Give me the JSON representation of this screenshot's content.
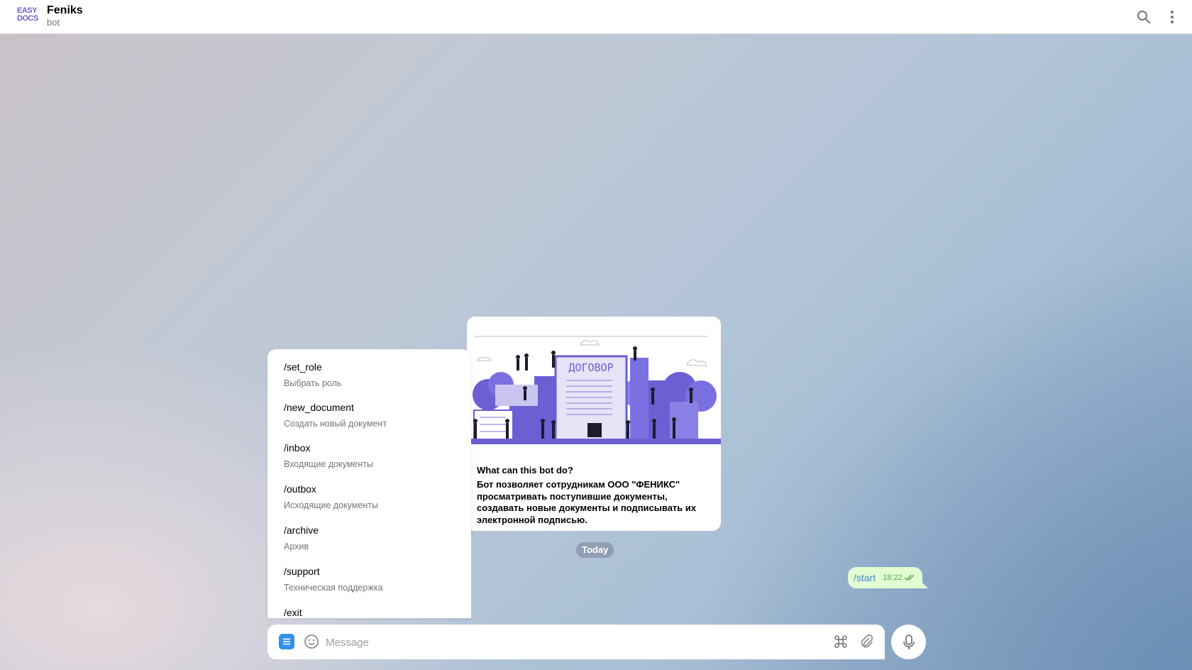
{
  "header": {
    "logo_line1": "EASY",
    "logo_line2": "DOCS",
    "title": "Feniks",
    "subtitle": "bot",
    "search_icon": "search-icon",
    "more_icon": "more-vertical-icon"
  },
  "info_card": {
    "image_label": "ДОГОВОР",
    "question": "What can this bot do?",
    "description": "Бот позволяет сотрудникам ООО \"ФЕНИКС\" просматривать поступившие документы, создавать новые документы и подписывать их электронной подписью."
  },
  "date_separator": "Today",
  "outgoing_message": {
    "text": "/start",
    "time": "18:22",
    "status_icon": "double-check-icon"
  },
  "commands": [
    {
      "name": "/set_role",
      "description": "Выбрать роль"
    },
    {
      "name": "/new_document",
      "description": "Создать новый документ"
    },
    {
      "name": "/inbox",
      "description": "Входящие документы"
    },
    {
      "name": "/outbox",
      "description": "Исходящие документы"
    },
    {
      "name": "/archive",
      "description": "Архив"
    },
    {
      "name": "/support",
      "description": "Техническая поддержка"
    },
    {
      "name": "/exit",
      "description": ""
    }
  ],
  "composer": {
    "placeholder": "Message",
    "value": "",
    "menu_icon": "bot-menu-icon",
    "emoji_icon": "emoji-icon",
    "commands_icon": "command-icon",
    "attach_icon": "paperclip-icon",
    "mic_icon": "microphone-icon"
  },
  "colors": {
    "accent": "#3390ec",
    "outgoing_bubble": "#e3fdd2",
    "logo": "#6a61c8",
    "illustration": "#6b5fd3"
  }
}
